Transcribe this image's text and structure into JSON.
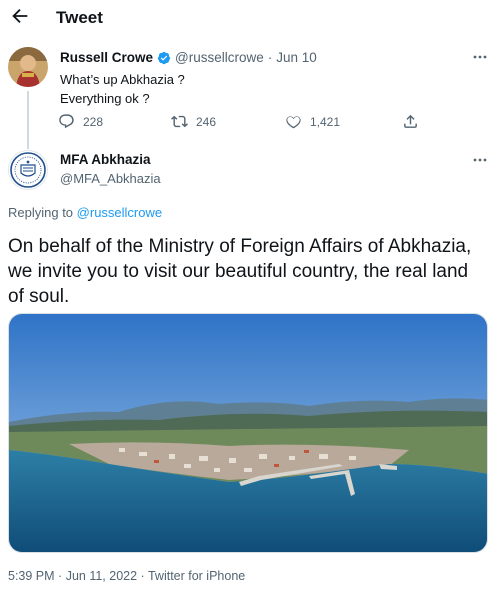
{
  "header": {
    "title": "Tweet",
    "back_icon": "arrow-left-icon"
  },
  "parent_tweet": {
    "name": "Russell Crowe",
    "handle": "@russellcrowe",
    "separator": "·",
    "date": "Jun 10",
    "text_lines": [
      "What’s up Abkhazia ?",
      "Everything ok ?"
    ],
    "replies": "228",
    "retweets": "246",
    "likes": "1,421",
    "verified_color": "#1d9bf0"
  },
  "main_tweet": {
    "name": "MFA Abkhazia",
    "handle": "@MFA_Abkhazia",
    "replying_prefix": "Replying to",
    "replying_to": "@russellcrowe",
    "text": "On behalf of the Ministry of Foreign Affairs of Abkhazia, we invite you to visit our beautiful country, the real land of soul.",
    "timestamp": "5:39 PM",
    "date_separator": "·",
    "date": "Jun 11, 2022",
    "source_separator": "·",
    "source": "Twitter for iPhone"
  },
  "colors": {
    "link": "#1d9bf0",
    "muted": "#536471",
    "text": "#0f1419"
  }
}
